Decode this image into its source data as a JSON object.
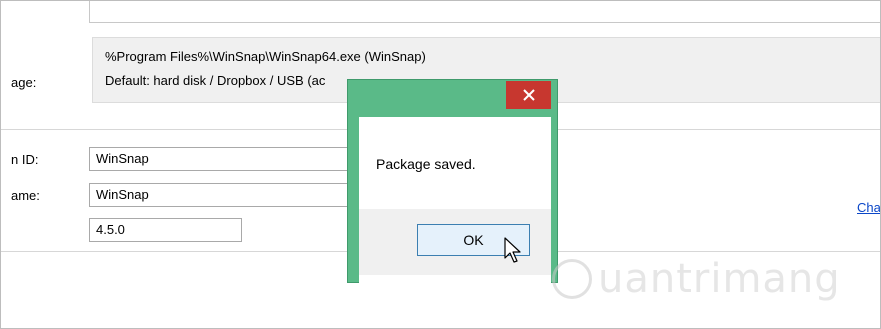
{
  "window": {
    "info_lines": [
      "%Program Files%\\WinSnap\\WinSnap64.exe (WinSnap)",
      "Default: hard disk / Dropbox / USB (ac"
    ],
    "labels": {
      "package": "age:",
      "app_id": "n ID:",
      "app_name": "ame:"
    },
    "fields": {
      "app_id": "WinSnap",
      "app_name": "WinSnap",
      "version": "4.5.0"
    },
    "link_text": "Cha"
  },
  "dialog": {
    "message": "Package saved.",
    "ok_label": "OK",
    "accent_color": "#5aba88",
    "close_color": "#c7372f"
  },
  "watermark": {
    "text": "uantrimang"
  }
}
